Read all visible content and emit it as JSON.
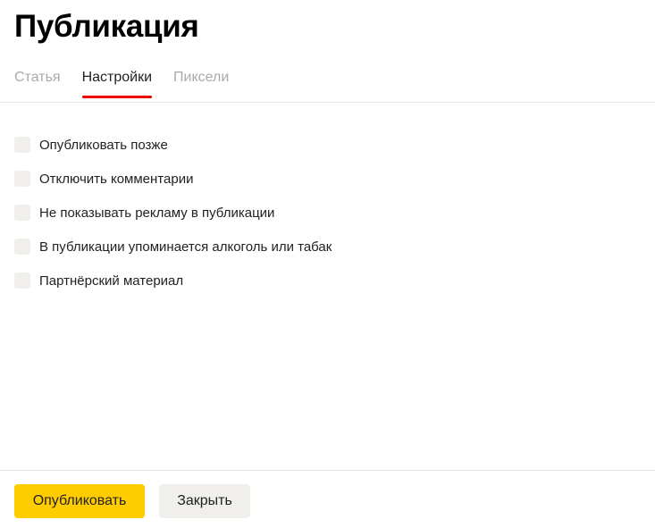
{
  "title": "Публикация",
  "tabs": [
    {
      "label": "Статья"
    },
    {
      "label": "Настройки",
      "active": true
    },
    {
      "label": "Пиксели"
    }
  ],
  "options": [
    {
      "label": "Опубликовать позже",
      "checked": false
    },
    {
      "label": "Отключить комментарии",
      "checked": false
    },
    {
      "label": "Не показывать рекламу в публикации",
      "checked": false
    },
    {
      "label": "В публикации упоминается алкоголь или табак",
      "checked": false
    },
    {
      "label": "Партнёрский материал",
      "checked": false
    }
  ],
  "buttons": {
    "publish": "Опубликовать",
    "close": "Закрыть"
  },
  "colors": {
    "accent": "#ffcc00",
    "tab_underline": "#ee0000"
  }
}
